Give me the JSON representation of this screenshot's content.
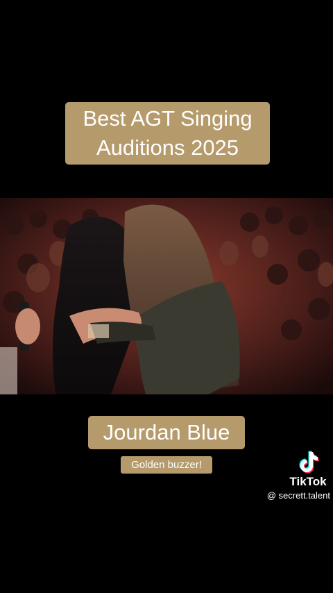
{
  "title": {
    "text": "Best AGT Singing Auditions 2025"
  },
  "video": {
    "description_icon": "photo-scene"
  },
  "caption": {
    "name": "Jourdan Blue",
    "subtitle": "Golden buzzer!"
  },
  "watermark": {
    "brand": "TikTok",
    "handle": "@ secrett.talent",
    "icon": "tiktok-logo-icon"
  },
  "colors": {
    "label_bg": "#b59a6c",
    "background": "#000000",
    "text": "#ffffff"
  }
}
